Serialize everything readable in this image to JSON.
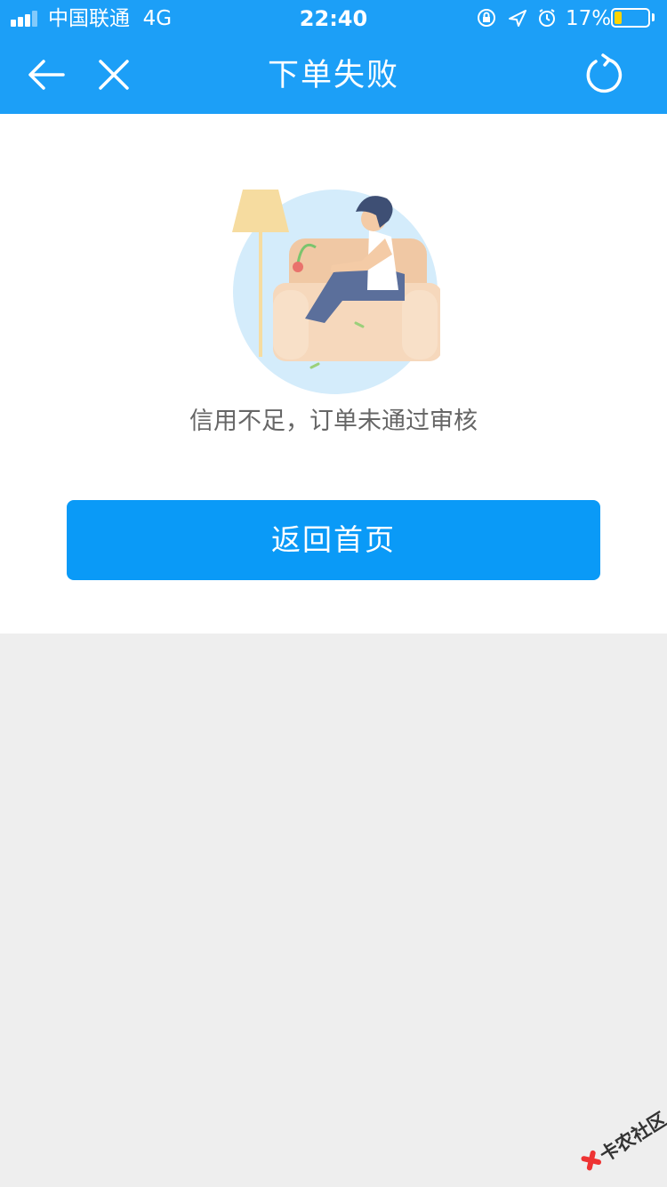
{
  "status_bar": {
    "carrier": "中国联通",
    "network": "4G",
    "time": "22:40",
    "battery_percent": "17%",
    "battery_level": 0.17,
    "icons": [
      "orientation-lock-icon",
      "location-icon",
      "alarm-icon"
    ]
  },
  "nav": {
    "title": "下单失败",
    "back_icon": "back-arrow-icon",
    "close_icon": "close-icon",
    "refresh_icon": "refresh-icon"
  },
  "result": {
    "illustration": "sad-person-on-sofa-illustration",
    "message": "信用不足，订单未通过审核",
    "button_label": "返回首页"
  },
  "watermark": {
    "text": "卡农社区"
  },
  "colors": {
    "nav_bar": "#1c9ff7",
    "button": "#0a9af7",
    "message_text": "#666666",
    "page_bg": "#eeeeee"
  }
}
